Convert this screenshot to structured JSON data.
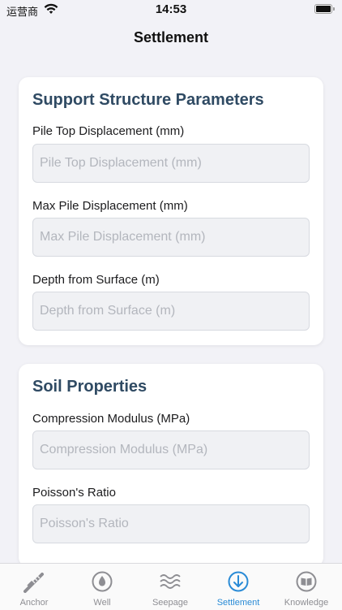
{
  "status_bar": {
    "carrier": "运营商",
    "time": "14:53",
    "wifi_icon": "wifi-icon",
    "battery_icon": "battery-icon"
  },
  "header": {
    "title": "Settlement"
  },
  "sections": [
    {
      "title": "Support Structure Parameters",
      "fields": [
        {
          "label": "Pile Top Displacement (mm)",
          "value": "",
          "placeholder": "Pile Top Displacement (mm)"
        },
        {
          "label": "Max Pile Displacement (mm)",
          "value": "",
          "placeholder": "Max Pile Displacement (mm)"
        },
        {
          "label": "Depth from Surface (m)",
          "value": "",
          "placeholder": "Depth from Surface (m)"
        }
      ]
    },
    {
      "title": "Soil Properties",
      "fields": [
        {
          "label": "Compression Modulus (MPa)",
          "value": "",
          "placeholder": "Compression Modulus (MPa)"
        },
        {
          "label": "Poisson's Ratio",
          "value": "",
          "placeholder": "Poisson's Ratio"
        }
      ]
    }
  ],
  "tab_bar": {
    "active": "Settlement",
    "tabs": [
      {
        "label": "Anchor",
        "icon": "anchor-bolt-icon"
      },
      {
        "label": "Well",
        "icon": "water-drop-icon"
      },
      {
        "label": "Seepage",
        "icon": "waves-icon"
      },
      {
        "label": "Settlement",
        "icon": "arrow-down-circle-icon"
      },
      {
        "label": "Knowledge",
        "icon": "book-icon"
      }
    ]
  },
  "colors": {
    "accent": "#2a8bd6",
    "section_title": "#2f4a63",
    "background": "#f2f2f7",
    "inactive_tab": "#8e8e93"
  }
}
